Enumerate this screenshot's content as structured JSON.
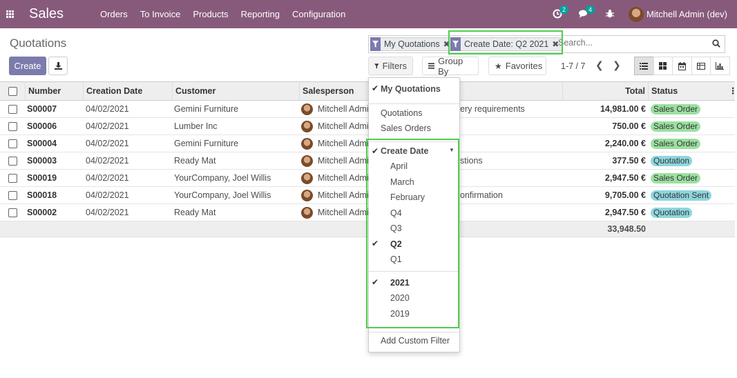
{
  "app": {
    "name": "Sales"
  },
  "menu": [
    "Orders",
    "To Invoice",
    "Products",
    "Reporting",
    "Configuration"
  ],
  "systray": {
    "activity_count": "2",
    "messages_count": "4",
    "user": "Mitchell Admin (dev)"
  },
  "control_panel": {
    "title": "Quotations",
    "create_label": "Create",
    "search": {
      "facets": [
        "My Quotations",
        "Create Date: Q2 2021"
      ],
      "placeholder": "Search..."
    },
    "filters_label": "Filters",
    "groupby_label": "Group By",
    "favorites_label": "Favorites",
    "pager": "1-7 / 7"
  },
  "table": {
    "columns": [
      "Number",
      "Creation Date",
      "Customer",
      "Salesperson",
      "Total",
      "Status"
    ],
    "rows": [
      {
        "number": "S00007",
        "date": "04/02/2021",
        "customer": "Gemini Furniture",
        "salesperson": "Mitchell Admi",
        "extra": "ery requirements",
        "total": "14,981.00 €",
        "status": "Sales Order"
      },
      {
        "number": "S00006",
        "date": "04/02/2021",
        "customer": "Lumber Inc",
        "salesperson": "Mitchell Admi",
        "extra": "",
        "total": "750.00 €",
        "status": "Sales Order"
      },
      {
        "number": "S00004",
        "date": "04/02/2021",
        "customer": "Gemini Furniture",
        "salesperson": "Mitchell Admi",
        "extra": "",
        "total": "2,240.00 €",
        "status": "Sales Order"
      },
      {
        "number": "S00003",
        "date": "04/02/2021",
        "customer": "Ready Mat",
        "salesperson": "Mitchell Admi",
        "extra": "stions",
        "total": "377.50 €",
        "status": "Quotation"
      },
      {
        "number": "S00019",
        "date": "04/02/2021",
        "customer": "YourCompany, Joel Willis",
        "salesperson": "Mitchell Admi",
        "extra": "",
        "total": "2,947.50 €",
        "status": "Sales Order"
      },
      {
        "number": "S00018",
        "date": "04/02/2021",
        "customer": "YourCompany, Joel Willis",
        "salesperson": "Mitchell Admi",
        "extra": "onfirmation",
        "total": "9,705.00 €",
        "status": "Quotation Sent"
      },
      {
        "number": "S00002",
        "date": "04/02/2021",
        "customer": "Ready Mat",
        "salesperson": "Mitchell Admi",
        "extra": "",
        "total": "2,947.50 €",
        "status": "Quotation"
      }
    ],
    "sum_total": "33,948.50"
  },
  "status_colors": {
    "Sales Order": "#9be0a0",
    "Quotation": "#8ed6de",
    "Quotation Sent": "#8ed6de"
  },
  "filters_dropdown": {
    "my_quotations": "My Quotations",
    "quotations": "Quotations",
    "sales_orders": "Sales Orders",
    "create_date": "Create Date",
    "periods": [
      "April",
      "March",
      "February",
      "Q4",
      "Q3",
      "Q2",
      "Q1"
    ],
    "years": [
      "2021",
      "2020",
      "2019"
    ],
    "add_custom": "Add Custom Filter"
  }
}
